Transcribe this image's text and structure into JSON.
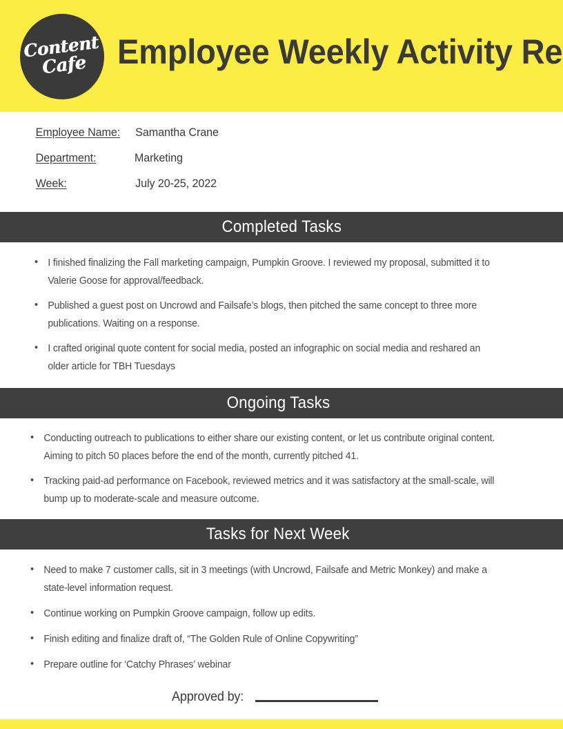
{
  "header": {
    "logo": {
      "line1": "Content",
      "line2": "Cafe",
      "background_color": "#3a3a3a",
      "text_color": "#ffffff"
    },
    "title": "Employee Weekly Activity Report",
    "band_color": "#fced44"
  },
  "meta": {
    "rows": [
      {
        "label": "Employee Name:",
        "value": "Samantha Crane"
      },
      {
        "label": "Department:",
        "value": "Marketing"
      },
      {
        "label": "Week:",
        "value": "July 20-25, 2022"
      }
    ]
  },
  "sections": [
    {
      "title": "Completed Tasks",
      "bar_color": "#3f3f3f",
      "items": [
        "I finished finalizing the Fall marketing campaign, Pumpkin Groove. I reviewed my proposal, submitted it to Valerie Goose for approval/feedback.",
        "Published a guest post on Uncrowd and Failsafe’s blogs, then pitched the same concept to three more publications. Waiting on a response.",
        "I crafted original quote content for social media, posted an infographic on social media and reshared an older article for TBH Tuesdays"
      ]
    },
    {
      "title": "Ongoing Tasks",
      "bar_color": "#3f3f3f",
      "items": [
        "Conducting outreach to publications to either share our existing content, or let us contribute original content. Aiming to pitch 50 places before the end of the month, currently pitched 41.",
        "Tracking paid-ad performance on Facebook, reviewed metrics and it was satisfactory at the small-scale, will bump up to moderate-scale and measure outcome."
      ]
    },
    {
      "title": "Tasks for Next Week",
      "bar_color": "#3f3f3f",
      "items": [
        "Need to make 7 customer calls, sit in 3 meetings (with Uncrowd, Failsafe and Metric Monkey) and make a state-level information request.",
        "Continue working on Pumpkin Groove campaign, follow up edits.",
        "Finish editing and finalize draft of, “The Golden Rule of Online Copywriting”",
        "Prepare outline for ‘Catchy Phrases’ webinar"
      ]
    }
  ],
  "signature": {
    "label": "Approved by:",
    "value": ""
  },
  "footer": {
    "band_color": "#fced44"
  }
}
